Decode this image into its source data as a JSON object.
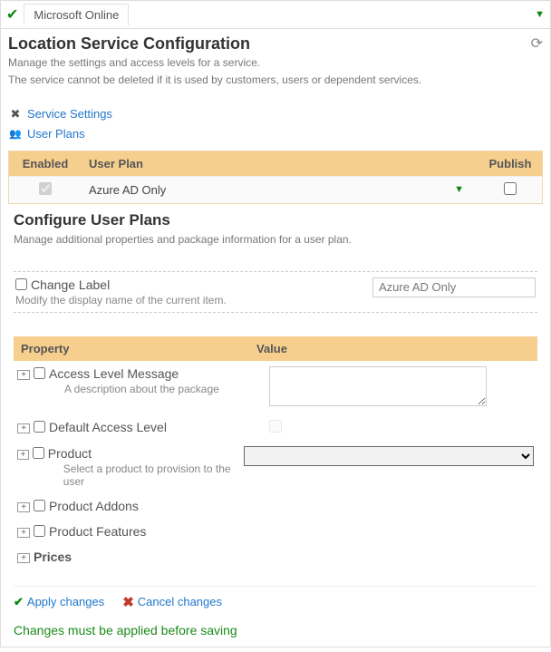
{
  "top": {
    "tab": "Microsoft Online"
  },
  "header": {
    "title": "Location Service Configuration",
    "sub1": "Manage the settings and access levels for a service.",
    "sub2": "The service cannot be deleted if it is used by customers, users or dependent services."
  },
  "links": {
    "service_settings": "Service Settings",
    "user_plans": "User Plans"
  },
  "table": {
    "col_enabled": "Enabled",
    "col_plan": "User Plan",
    "col_publish": "Publish",
    "rows": [
      {
        "plan": "Azure AD Only",
        "enabled": true,
        "publish": false
      }
    ]
  },
  "config": {
    "title": "Configure User Plans",
    "sub": "Manage additional properties and package information for a user plan.",
    "change_label": "Change Label",
    "change_label_hint": "Modify the display name of the current item.",
    "label_value": "Azure AD Only"
  },
  "props": {
    "col_prop": "Property",
    "col_val": "Value",
    "items": {
      "access_msg": "Access Level Message",
      "access_msg_hint": "A description about the package",
      "default_level": "Default Access Level",
      "product": "Product",
      "product_hint": "Select a product to provision to the user",
      "addons": "Product Addons",
      "features": "Product Features",
      "prices": "Prices"
    }
  },
  "actions": {
    "apply": "Apply changes",
    "cancel": "Cancel changes"
  },
  "warning": "Changes must be applied before saving"
}
